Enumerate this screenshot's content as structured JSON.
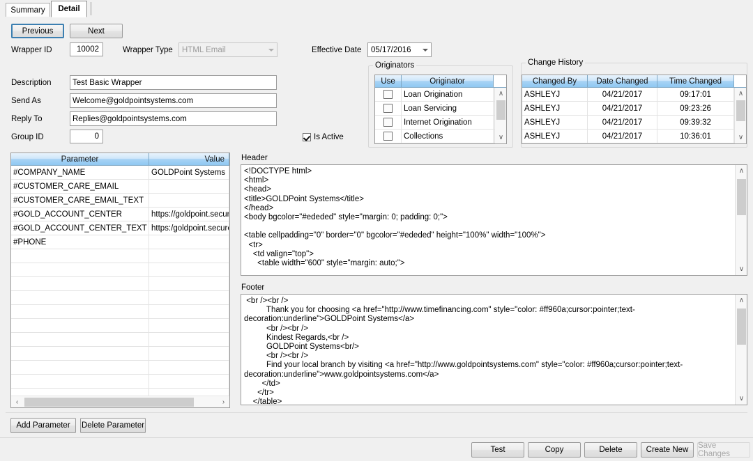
{
  "tabs": [
    {
      "label": "Summary",
      "active": false
    },
    {
      "label": "Detail",
      "active": true
    }
  ],
  "nav": {
    "previous_label": "Previous",
    "next_label": "Next"
  },
  "fields": {
    "wrapper_id_label": "Wrapper ID",
    "wrapper_id_value": "10002",
    "wrapper_type_label": "Wrapper Type",
    "wrapper_type_value": "HTML Email",
    "effective_date_label": "Effective Date",
    "effective_date_value": "05/17/2016",
    "description_label": "Description",
    "description_value": "Test Basic Wrapper",
    "send_as_label": "Send As",
    "send_as_value": "Welcome@goldpointsystems.com",
    "reply_to_label": "Reply To",
    "reply_to_value": "Replies@goldpointsystems.com",
    "group_id_label": "Group ID",
    "group_id_value": "0",
    "is_active_label": "Is Active",
    "is_active_checked": true
  },
  "originators": {
    "group_label": "Originators",
    "columns": [
      "Use",
      "Originator"
    ],
    "rows": [
      {
        "use": false,
        "name": "Loan Origination"
      },
      {
        "use": false,
        "name": "Loan Servicing"
      },
      {
        "use": false,
        "name": "Internet Origination"
      },
      {
        "use": false,
        "name": "Collections"
      }
    ]
  },
  "change_history": {
    "group_label": "Change History",
    "columns": [
      "Changed By",
      "Date Changed",
      "Time Changed"
    ],
    "rows": [
      {
        "changed_by": "ASHLEYJ",
        "date_changed": "04/21/2017",
        "time_changed": "09:17:01"
      },
      {
        "changed_by": "ASHLEYJ",
        "date_changed": "04/21/2017",
        "time_changed": "09:23:26"
      },
      {
        "changed_by": "ASHLEYJ",
        "date_changed": "04/21/2017",
        "time_changed": "09:39:32"
      },
      {
        "changed_by": "ASHLEYJ",
        "date_changed": "04/21/2017",
        "time_changed": "10:36:01"
      }
    ]
  },
  "parameters": {
    "columns": [
      "Parameter",
      "Value"
    ],
    "rows": [
      {
        "parameter": "#COMPANY_NAME",
        "value": "GOLDPoint Systems"
      },
      {
        "parameter": "#CUSTOMER_CARE_EMAIL",
        "value": ""
      },
      {
        "parameter": "#CUSTOMER_CARE_EMAIL_TEXT",
        "value": ""
      },
      {
        "parameter": "#GOLD_ACCOUNT_CENTER",
        "value": "https://goldpoint.secure"
      },
      {
        "parameter": "#GOLD_ACCOUNT_CENTER_TEXT",
        "value": "https:/goldpoint.secure"
      },
      {
        "parameter": "#PHONE",
        "value": ""
      },
      {
        "parameter": "",
        "value": ""
      },
      {
        "parameter": "",
        "value": ""
      },
      {
        "parameter": "",
        "value": ""
      },
      {
        "parameter": "",
        "value": ""
      },
      {
        "parameter": "",
        "value": ""
      },
      {
        "parameter": "",
        "value": ""
      },
      {
        "parameter": "",
        "value": ""
      },
      {
        "parameter": "",
        "value": ""
      },
      {
        "parameter": "",
        "value": ""
      },
      {
        "parameter": "",
        "value": ""
      },
      {
        "parameter": "",
        "value": ""
      },
      {
        "parameter": "",
        "value": ""
      }
    ],
    "add_label": "Add Parameter",
    "delete_label": "Delete Parameter"
  },
  "header_section": {
    "label": "Header",
    "content": "<!DOCTYPE html>\n<html>\n<head>\n<title>GOLDPoint Systems</title>\n</head>\n<body bgcolor=\"#ededed\" style=\"margin: 0; padding: 0;\">\n\n<table cellpadding=\"0\" border=\"0\" bgcolor=\"#ededed\" height=\"100%\" width=\"100%\">\n  <tr>\n    <td valign=\"top\">\n      <table width=\"600\" style=\"margin: auto;\">"
  },
  "footer_section": {
    "label": "Footer",
    "content": " <br /><br />\n          Thank you for choosing <a href=\"http://www.timefinancing.com\" style=\"color: #ff960a;cursor:pointer;text-decoration:underline\">GOLDPoint Systems</a>\n          <br /><br />\n          Kindest Regards,<br />\n          GOLDPoint Systems<br/>\n          <br /><br />\n          Find your local branch by visiting <a href=\"http://www.goldpointsystems.com\" style=\"color: #ff960a;cursor:pointer;text-decoration:underline\">www.goldpointsystems.com</a>\n        </td>\n      </tr>\n    </table>"
  },
  "actions": {
    "test_label": "Test",
    "copy_label": "Copy",
    "delete_label": "Delete",
    "create_new_label": "Create New",
    "save_changes_label": "Save Changes"
  },
  "icons": {
    "chevron_down": "▼",
    "scroll_up": "∧",
    "scroll_down": "∨",
    "scroll_left": "‹",
    "scroll_right": "›"
  }
}
